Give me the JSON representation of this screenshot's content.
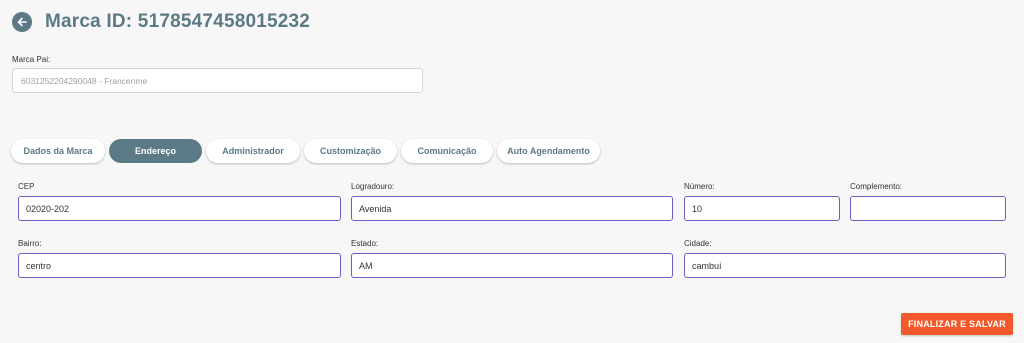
{
  "header": {
    "title": "Marca ID: 5178547458015232",
    "back_icon": "arrow-left-icon"
  },
  "parent_brand": {
    "label": "Marca Pai:",
    "value": "6031252204290048 - Francenme"
  },
  "tabs": [
    {
      "label": "Dados da Marca",
      "active": false
    },
    {
      "label": "Endereço",
      "active": true
    },
    {
      "label": "Administrador",
      "active": false
    },
    {
      "label": "Customização",
      "active": false
    },
    {
      "label": "Comunicação",
      "active": false
    },
    {
      "label": "Auto Agendamento",
      "active": false
    }
  ],
  "address": {
    "cep": {
      "label": "CEP",
      "value": "02020-202"
    },
    "logradouro": {
      "label": "Logradouro:",
      "value": "Avenida"
    },
    "numero": {
      "label": "Número:",
      "value": "10"
    },
    "complemento": {
      "label": "Complemento:",
      "value": ""
    },
    "bairro": {
      "label": "Bairro:",
      "value": "centro"
    },
    "estado": {
      "label": "Estado:",
      "value": "AM"
    },
    "cidade": {
      "label": "Cidade:",
      "value": "cambuí"
    }
  },
  "actions": {
    "save_label": "FINALIZAR E SALVAR"
  },
  "colors": {
    "primary": "#5b7a86",
    "accent": "#f1592a",
    "field_border": "#6b5fc7"
  }
}
